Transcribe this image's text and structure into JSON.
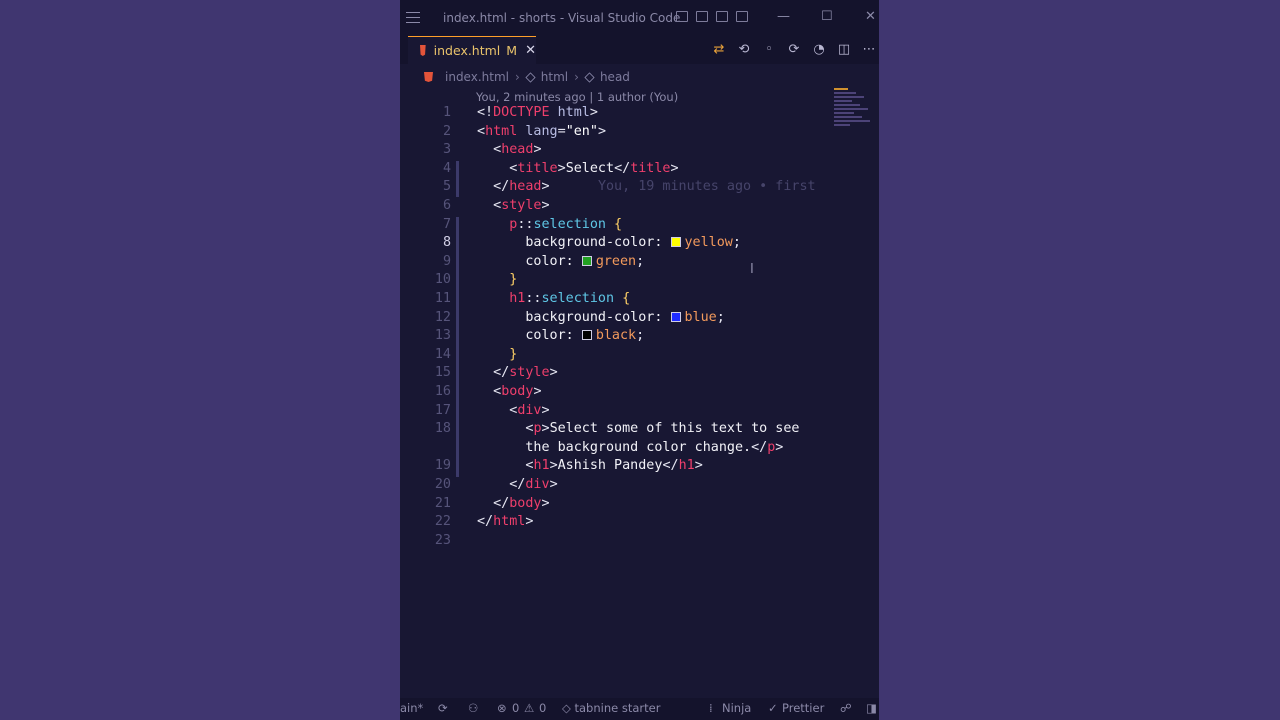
{
  "window": {
    "title": "index.html - shorts - Visual Studio Code"
  },
  "tab": {
    "filename": "index.html",
    "modified_marker": "M",
    "close_glyph": "✕"
  },
  "breadcrumb": {
    "file": "index.html",
    "node1": "html",
    "node2": "head"
  },
  "blame": {
    "header": "You, 2 minutes ago | 1 author (You)",
    "inline": "You, 19 minutes ago • first"
  },
  "editor": {
    "active_line": 8,
    "line_numbers": [
      "1",
      "2",
      "3",
      "4",
      "5",
      "6",
      "7",
      "8",
      "9",
      "10",
      "11",
      "12",
      "13",
      "14",
      "15",
      "16",
      "17",
      "18",
      "",
      "19",
      "20",
      "21",
      "22",
      "23"
    ],
    "lines": {
      "l1": [
        "<!",
        "DOCTYPE",
        " html",
        ">"
      ],
      "l2": [
        "<",
        "html",
        " lang",
        "=",
        "\"en\"",
        ">"
      ],
      "l3": [
        "<",
        "head",
        ">"
      ],
      "l4": [
        "<",
        "title",
        ">",
        "Select",
        "</",
        "title",
        ">"
      ],
      "l5": [
        "</",
        "head",
        ">"
      ],
      "l6": [
        "<",
        "style",
        ">"
      ],
      "l7": [
        "p",
        "::",
        "selection",
        " {"
      ],
      "l8": [
        "background-color:",
        "yellow",
        ";"
      ],
      "l9": [
        "color:",
        "green",
        ";"
      ],
      "l10": [
        "}"
      ],
      "l11": [
        "h1",
        "::",
        "selection",
        " {"
      ],
      "l12": [
        "background-color:",
        "blue",
        ";"
      ],
      "l13": [
        "color:",
        "black",
        ";"
      ],
      "l14": [
        "}"
      ],
      "l15": [
        "</",
        "style",
        ">"
      ],
      "l16": [
        "<",
        "body",
        ">"
      ],
      "l17": [
        "<",
        "div",
        ">"
      ],
      "l18": [
        "<",
        "p",
        ">",
        "Select some of this text to see"
      ],
      "l18b": [
        "the background color change.",
        "</",
        "p",
        ">"
      ],
      "l19": [
        "<",
        "h1",
        ">",
        "Ashish Pandey",
        "</",
        "h1",
        ">"
      ],
      "l20": [
        "</",
        "div",
        ">"
      ],
      "l21": [
        "</",
        "body",
        ">"
      ],
      "l22": [
        "</",
        "html",
        ">"
      ]
    }
  },
  "colors": {
    "yellow": "#ffff00",
    "green": "#22a022",
    "blue": "#1f2bff",
    "black": "#000000"
  },
  "status": {
    "branch": "ain*",
    "errors": "0",
    "warnings": "0",
    "tabnine": "tabnine starter",
    "ninja": "Ninja",
    "prettier": "Prettier"
  }
}
